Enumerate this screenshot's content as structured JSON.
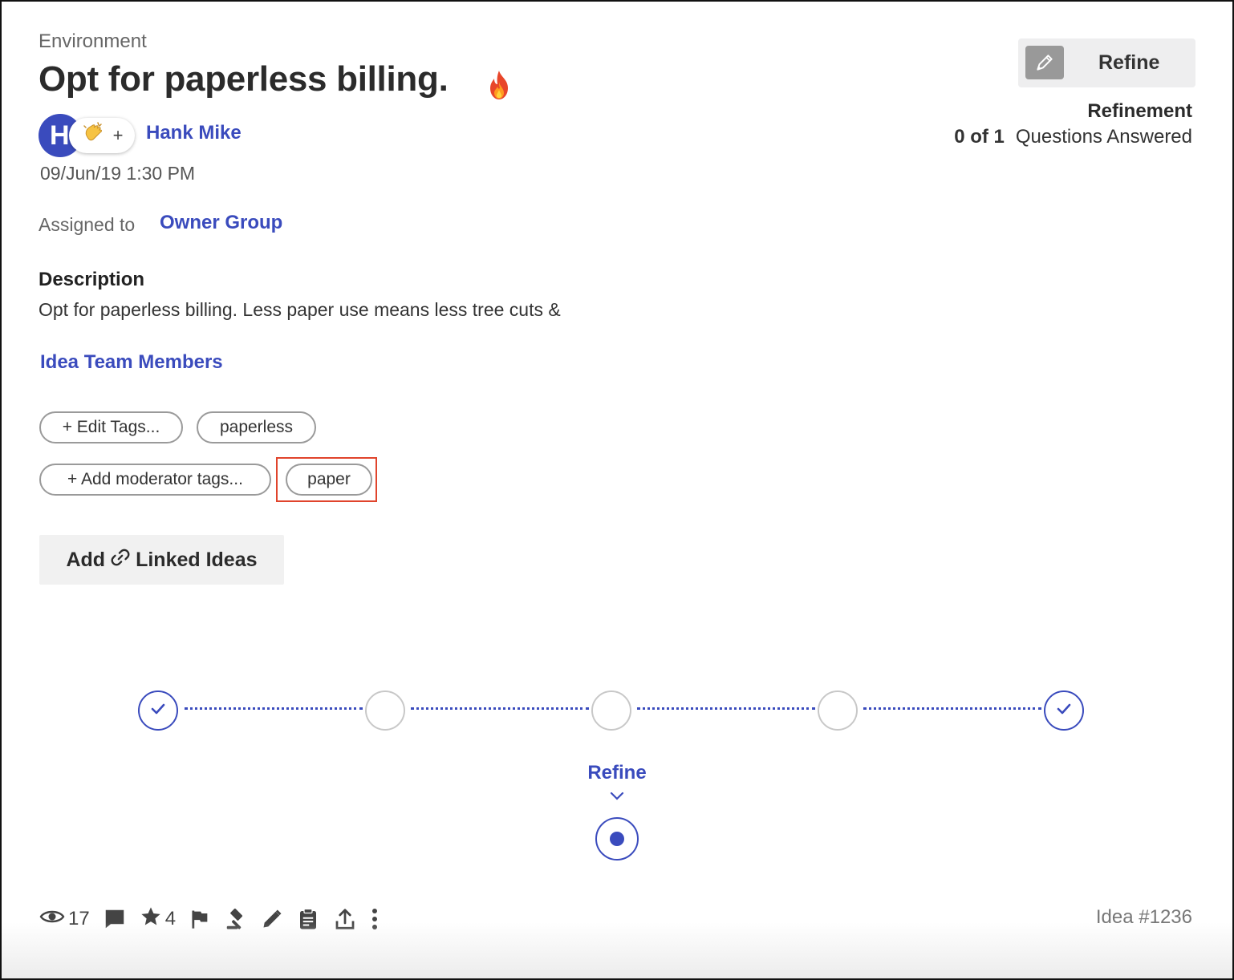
{
  "idea": {
    "category": "Environment",
    "title": "Opt for paperless billing.",
    "title_icon": "fire-icon",
    "author_initial": "H",
    "reaction_plus": "+",
    "author": "Hank Mike",
    "date": "09/Jun/19 1:30 PM",
    "assigned_label": "Assigned to",
    "assigned_to": "Owner Group",
    "description_heading": "Description",
    "description": "Opt for paperless billing. Less paper use means less tree cuts &",
    "team_link": "Idea Team Members",
    "edit_tags_label": "+ Edit Tags...",
    "tags": [
      "paperless"
    ],
    "add_moderator_tags_label": "+ Add moderator tags...",
    "moderator_tags": [
      "paper"
    ],
    "linked_ideas": {
      "prefix": "Add",
      "suffix": "Linked Ideas",
      "icon": "link-icon"
    },
    "id_label": "Idea #1236"
  },
  "refine_panel": {
    "button_label": "Refine",
    "button_icon": "pencil-icon",
    "heading": "Refinement",
    "count": "0 of 1",
    "count_suffix": "Questions Answered"
  },
  "workflow": {
    "stages": [
      "complete",
      "pending",
      "pending",
      "pending",
      "complete"
    ],
    "current_stage_label": "Refine"
  },
  "footer": {
    "views": "17",
    "stars": "4",
    "icons": [
      "eye-icon",
      "comment-icon",
      "star-icon",
      "flag-icon",
      "gavel-icon",
      "pencil-icon",
      "clipboard-icon",
      "share-icon",
      "more-icon"
    ]
  },
  "colors": {
    "accent": "#3a4bbd",
    "highlight": "#e0442c",
    "pending_step": "#c8c8c8"
  }
}
